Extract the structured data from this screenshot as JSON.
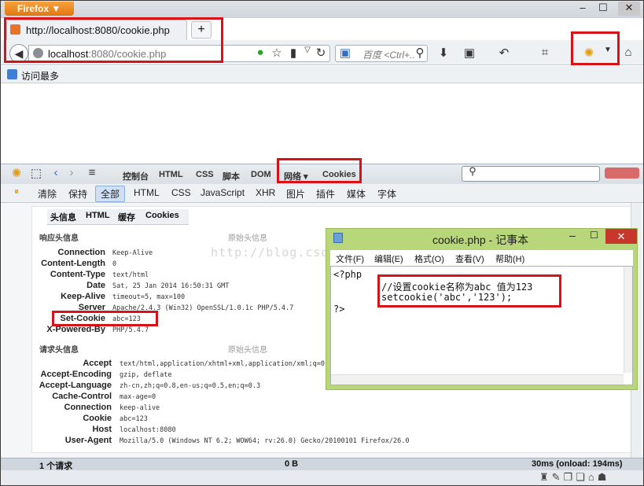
{
  "browser": {
    "app_button": "Firefox ▼",
    "tab_title": "http://localhost:8080/cookie.php",
    "new_tab": "+",
    "url_host": "localhost",
    "url_rest": ":8080/cookie.php",
    "search_placeholder": "百度 <Ctrl+..",
    "bookmark": "访问最多",
    "win_min": "–",
    "win_max": "☐",
    "win_close": "✕"
  },
  "firebug": {
    "tabs": [
      "控制台",
      "HTML",
      "CSS",
      "脚本",
      "DOM",
      "网络 ▾",
      "Cookies"
    ],
    "net_filters": [
      "清除",
      "保持",
      "全部",
      "HTML",
      "CSS",
      "JavaScript",
      "XHR",
      "图片",
      "插件",
      "媒体",
      "字体"
    ],
    "request_tabs": [
      "头信息",
      "HTML",
      "缓存",
      "Cookies"
    ],
    "response_section": "响应头信息",
    "request_section": "请求头信息",
    "raw_label": "原始头信息",
    "response_headers": [
      {
        "name": "Connection",
        "value": "Keep-Alive"
      },
      {
        "name": "Content-Length",
        "value": "0"
      },
      {
        "name": "Content-Type",
        "value": "text/html"
      },
      {
        "name": "Date",
        "value": "Sat, 25 Jan 2014 16:50:31 GMT"
      },
      {
        "name": "Keep-Alive",
        "value": "timeout=5, max=100"
      },
      {
        "name": "Server",
        "value": "Apache/2.4.3 (Win32) OpenSSL/1.0.1c PHP/5.4.7"
      },
      {
        "name": "Set-Cookie",
        "value": "abc=123"
      },
      {
        "name": "X-Powered-By",
        "value": "PHP/5.4.7"
      }
    ],
    "request_headers": [
      {
        "name": "Accept",
        "value": "text/html,application/xhtml+xml,application/xml;q=0"
      },
      {
        "name": "Accept-Encoding",
        "value": "gzip, deflate"
      },
      {
        "name": "Accept-Language",
        "value": "zh-cn,zh;q=0.8,en-us;q=0.5,en;q=0.3"
      },
      {
        "name": "Cache-Control",
        "value": "max-age=0"
      },
      {
        "name": "Connection",
        "value": "keep-alive"
      },
      {
        "name": "Cookie",
        "value": "abc=123"
      },
      {
        "name": "Host",
        "value": "localhost:8080"
      },
      {
        "name": "User-Agent",
        "value": "Mozilla/5.0 (Windows NT 6.2; WOW64; rv:26.0) Gecko/20100101 Firefox/26.0"
      }
    ],
    "status_requests": "1 个请求",
    "status_size": "0 B",
    "status_time": "30ms (onload: 194ms)"
  },
  "notepad": {
    "title": "cookie.php - 记事本",
    "menu": [
      "文件(F)",
      "编辑(E)",
      "格式(O)",
      "查看(V)",
      "帮助(H)"
    ],
    "line1": "<?php",
    "line2": "//设置cookie名称为abc 值为123",
    "line3": "setcookie('abc','123');",
    "line4": "?>"
  },
  "watermark": "http://blog.csdn.net/..."
}
